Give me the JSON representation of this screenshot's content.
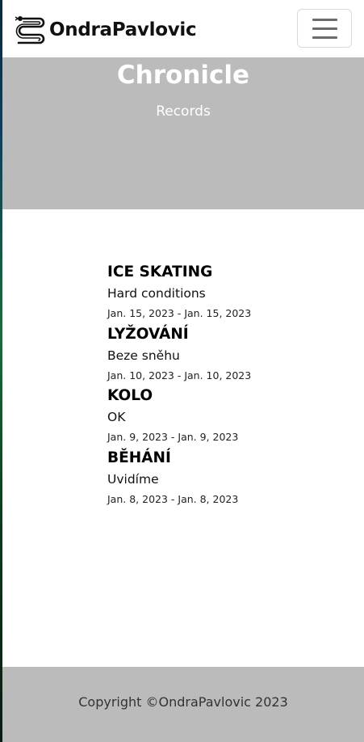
{
  "navbar": {
    "brand_name": "OndraPavlovic",
    "brand_icon": "snake-logo-icon",
    "toggler_icon": "hamburger-menu-icon"
  },
  "hero": {
    "title": "Chronicle",
    "subtitle": "Records"
  },
  "records": [
    {
      "title": "ICE SKATING",
      "description": "Hard conditions",
      "dates": "Jan. 15, 2023 - Jan. 15, 2023"
    },
    {
      "title": "LYŽOVÁNÍ",
      "description": "Beze sněhu",
      "dates": "Jan. 10, 2023 - Jan. 10, 2023"
    },
    {
      "title": "KOLO",
      "description": "OK",
      "dates": "Jan. 9, 2023 - Jan. 9, 2023"
    },
    {
      "title": "BĚHÁNÍ",
      "description": "Uvidíme",
      "dates": "Jan. 8, 2023 - Jan. 8, 2023"
    }
  ],
  "footer": {
    "copyright": "Copyright ©OndraPavlovic 2023"
  },
  "colors": {
    "hero_background": "#bbbbbb",
    "footer_background": "#bbbbbb",
    "page_background": "#ffffff"
  }
}
